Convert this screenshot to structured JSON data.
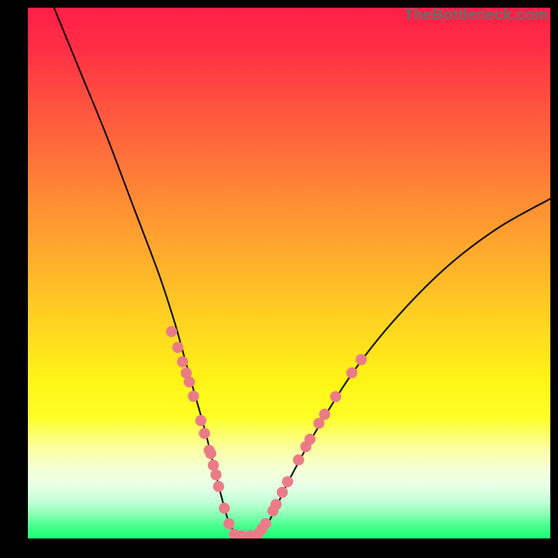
{
  "watermark": {
    "text": "TheBottleneck.com"
  },
  "chart_data": {
    "type": "line",
    "title": "",
    "xlabel": "",
    "ylabel": "",
    "xlim": [
      0,
      100
    ],
    "ylim": [
      0,
      100
    ],
    "series": [
      {
        "name": "bottleneck-curve",
        "x": [
          5,
          10,
          15,
          20,
          25,
          28,
          30,
          32,
          34,
          36,
          38.5,
          41,
          43,
          46,
          50,
          55,
          62,
          70,
          80,
          90,
          100
        ],
        "y": [
          100,
          88,
          76,
          63,
          50,
          41,
          34,
          27,
          20,
          12,
          3,
          0,
          0,
          3,
          11,
          20,
          31,
          41,
          51,
          58.5,
          64
        ]
      }
    ],
    "markers": [
      {
        "series": "left-cluster",
        "points": [
          {
            "x": 27.5,
            "y": 39
          },
          {
            "x": 28.7,
            "y": 36
          },
          {
            "x": 29.6,
            "y": 33.3
          },
          {
            "x": 30.3,
            "y": 31.2
          },
          {
            "x": 30.9,
            "y": 29.5
          },
          {
            "x": 31.7,
            "y": 26.8
          },
          {
            "x": 33.1,
            "y": 22.2
          },
          {
            "x": 33.8,
            "y": 19.8
          },
          {
            "x": 34.7,
            "y": 16.6
          },
          {
            "x": 35.0,
            "y": 16
          },
          {
            "x": 35.5,
            "y": 13.8
          },
          {
            "x": 36.0,
            "y": 12
          },
          {
            "x": 36.5,
            "y": 9.8
          },
          {
            "x": 37.6,
            "y": 5.7
          },
          {
            "x": 38.5,
            "y": 2.8
          }
        ]
      },
      {
        "series": "bottom-flat",
        "points": [
          {
            "x": 39.5,
            "y": 0.8
          },
          {
            "x": 40.9,
            "y": 0.5
          },
          {
            "x": 42.5,
            "y": 0.5
          },
          {
            "x": 44.0,
            "y": 0.8
          }
        ]
      },
      {
        "series": "right-cluster",
        "points": [
          {
            "x": 44.8,
            "y": 1.8
          },
          {
            "x": 45.5,
            "y": 2.8
          },
          {
            "x": 46.9,
            "y": 5.2
          },
          {
            "x": 47.5,
            "y": 6.4
          },
          {
            "x": 48.7,
            "y": 8.7
          },
          {
            "x": 49.7,
            "y": 10.7
          },
          {
            "x": 51.8,
            "y": 14.8
          },
          {
            "x": 53.2,
            "y": 17.3
          },
          {
            "x": 54.0,
            "y": 18.7
          },
          {
            "x": 55.7,
            "y": 21.7
          },
          {
            "x": 56.8,
            "y": 23.4
          },
          {
            "x": 58.9,
            "y": 26.7
          },
          {
            "x": 62.0,
            "y": 31.2
          },
          {
            "x": 63.8,
            "y": 33.7
          }
        ]
      }
    ],
    "marker_style": {
      "color": "#eb7c87",
      "radius_px": 8
    }
  }
}
